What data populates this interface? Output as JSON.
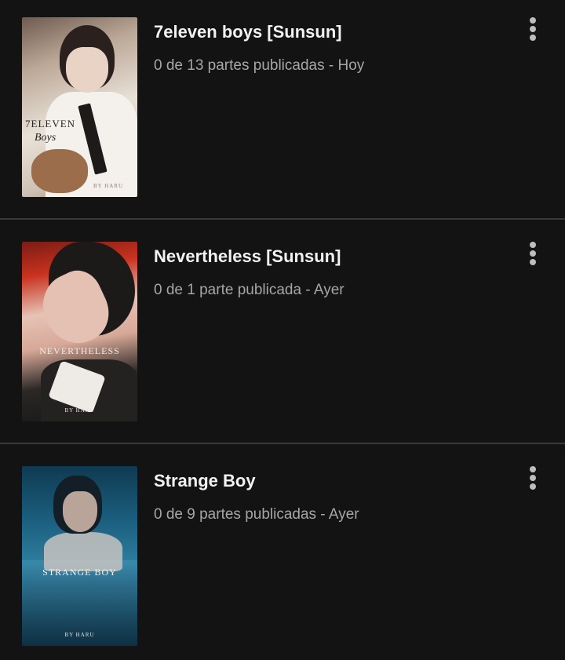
{
  "stories": [
    {
      "title": "7eleven boys [Sunsun]",
      "parts_info": "0 de 13 partes publicadas - Hoy",
      "cover": {
        "title": "7ELEVEN",
        "subtitle": "Boys",
        "author": "BY HARU"
      },
      "menu_icon": "more-vertical-icon"
    },
    {
      "title": "Nevertheless [Sunsun]",
      "parts_info": "0 de 1 parte publicada - Ayer",
      "cover": {
        "title": "NEVERTHELESS",
        "author": "BY HARU"
      },
      "menu_icon": "more-vertical-icon"
    },
    {
      "title": "Strange Boy",
      "parts_info": "0 de 9 partes publicadas - Ayer",
      "cover": {
        "title": "STRANGE BOY",
        "author": "BY HARU"
      },
      "menu_icon": "more-vertical-icon"
    }
  ],
  "colors": {
    "background": "#121212",
    "title_text": "#f2f2f2",
    "meta_text": "#a6a6a6",
    "divider": "#3a3a3a"
  }
}
